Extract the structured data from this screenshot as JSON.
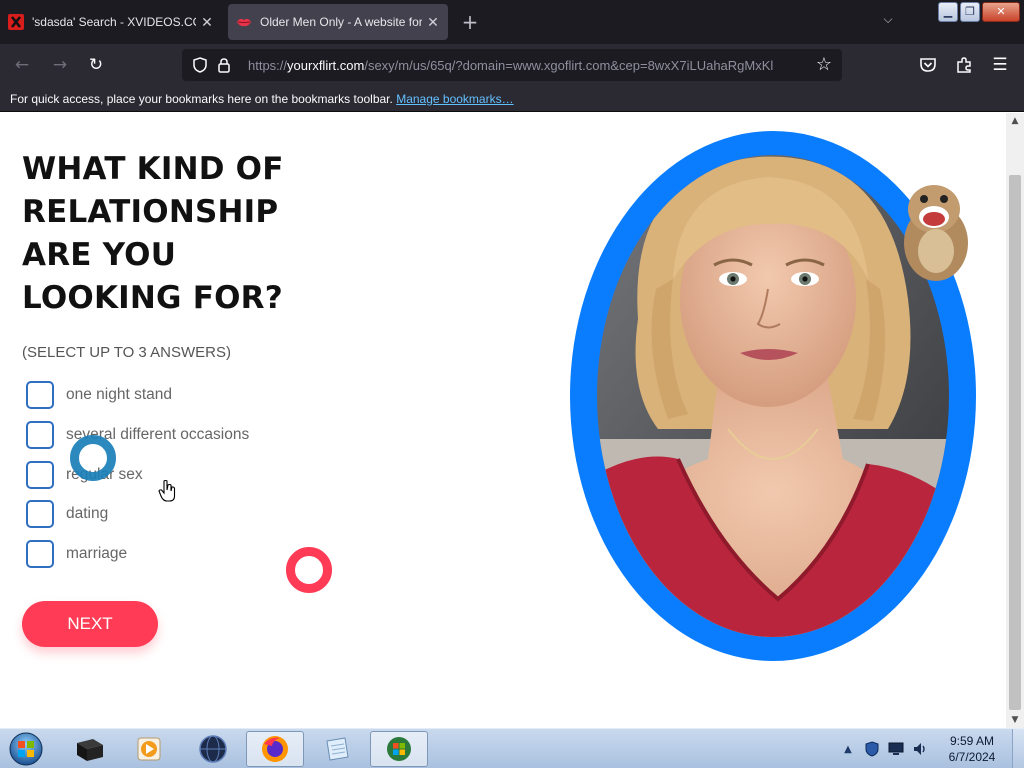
{
  "browser": {
    "tabs": [
      {
        "title": "'sdasda' Search - XVIDEOS.COM",
        "icon": "x-logo-icon"
      },
      {
        "title": "Older Men Only - A website for",
        "icon": "lips-icon"
      }
    ],
    "new_tab_label": "+",
    "url": {
      "scheme": "https://",
      "host": "yourxflirt.com",
      "path": "/sexy/m/us/65q/?domain=www.xgoflirt.com&cep=8wxX7iLUahaRgMxKl"
    },
    "bookmarks_text": "For quick access, place your bookmarks here on the bookmarks toolbar.",
    "bookmarks_link": "Manage bookmarks…"
  },
  "page": {
    "question": "WHAT KIND OF RELATIONSHIP ARE YOU LOOKING FOR?",
    "hint": "(SELECT UP TO 3 ANSWERS)",
    "options": [
      {
        "label": "one night stand",
        "checked": false
      },
      {
        "label": "several different occasions",
        "checked": false
      },
      {
        "label": "regular sex",
        "checked": false
      },
      {
        "label": "dating",
        "checked": false
      },
      {
        "label": "marriage",
        "checked": false
      }
    ],
    "next_label": "NEXT",
    "accent_color": "#ff3b55",
    "checkbox_color": "#2f6fc0",
    "frame_color": "#0a7dff"
  },
  "taskbar": {
    "apps": [
      "black-box-app-icon",
      "media-player-icon",
      "globe-app-icon",
      "firefox-icon",
      "notepad-icon",
      "windows-flag-app-icon"
    ],
    "time": "9:59 AM",
    "date": "6/7/2024"
  }
}
